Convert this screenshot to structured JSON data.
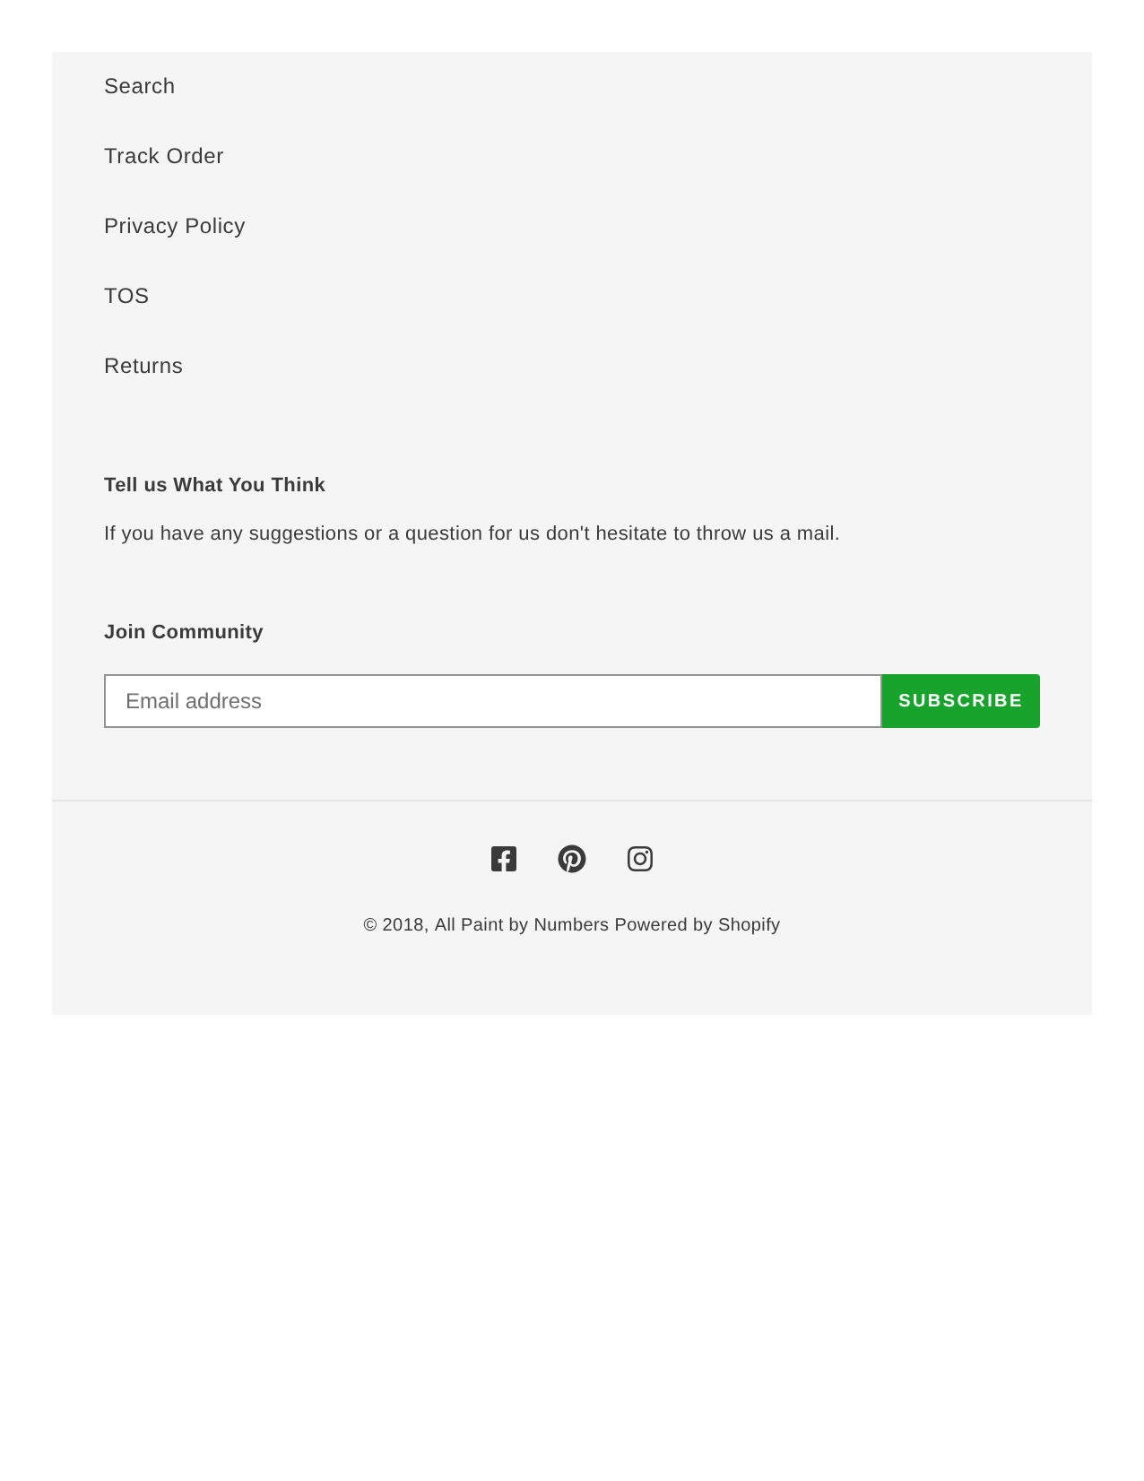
{
  "links": [
    "Search",
    "Track Order",
    "Privacy Policy",
    "TOS",
    "Returns"
  ],
  "contact": {
    "heading": "Tell us What You Think",
    "text": "If you have any suggestions or a question for us don't hesitate to throw us a mail."
  },
  "newsletter": {
    "heading": "Join Community",
    "placeholder": "Email address",
    "button": "SUBSCRIBE"
  },
  "social": [
    {
      "kind": "facebook"
    },
    {
      "kind": "pinterest"
    },
    {
      "kind": "instagram"
    }
  ],
  "copyright": {
    "prefix": "© 2018,",
    "store_link": "All Paint by Numbers",
    "powered_link": "Powered by Shopify"
  }
}
